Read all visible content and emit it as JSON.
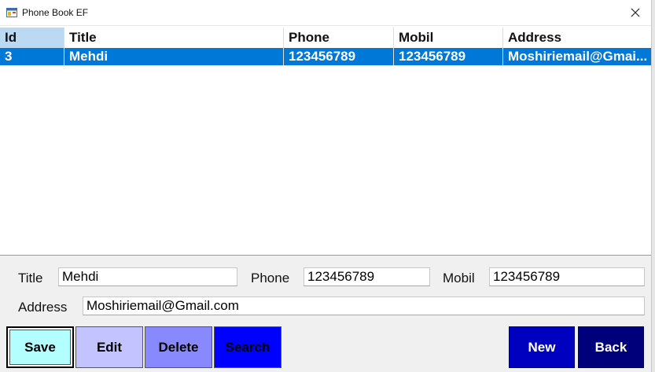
{
  "window": {
    "title": "Phone Book EF",
    "icon": "form-icon",
    "close_icon": "close-icon"
  },
  "grid": {
    "columns": [
      "Id",
      "Title",
      "Phone",
      "Mobil",
      "Address"
    ],
    "rows": [
      {
        "id": "3",
        "title": "Mehdi",
        "phone": "123456789",
        "mobil": "123456789",
        "address": "Moshiriemail@Gmai..."
      }
    ]
  },
  "form": {
    "title_label": "Title",
    "title_value": "Mehdi",
    "phone_label": "Phone",
    "phone_value": "123456789",
    "mobil_label": "Mobil",
    "mobil_value": "123456789",
    "address_label": "Address",
    "address_value": "Moshiriemail@Gmail.com"
  },
  "buttons": {
    "save": "Save",
    "edit": "Edit",
    "delete": "Delete",
    "search": "Search",
    "new": "New",
    "back": "Back"
  },
  "colors": {
    "selection": "#0078d7",
    "header_active": "#bcd9f4",
    "save": "#b3ffff",
    "edit": "#c3c3ff",
    "delete": "#8989ff",
    "search": "#0000ff",
    "new": "#0000c0",
    "back": "#00007a"
  }
}
